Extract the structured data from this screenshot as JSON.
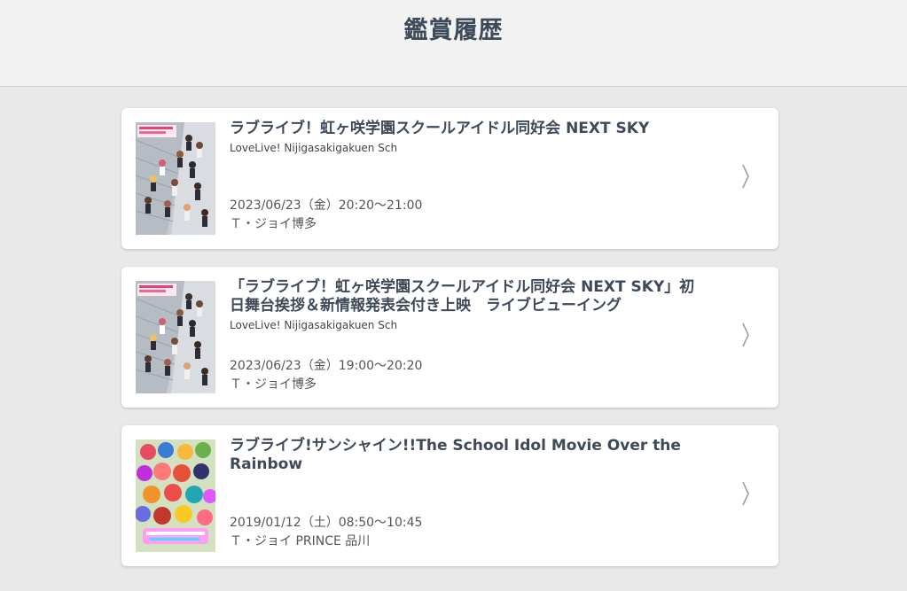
{
  "header": {
    "title": "鑑賞履歴"
  },
  "history": [
    {
      "title": "ラブライブ！虹ヶ咲学園スクールアイドル同好会 NEXT SKY",
      "subtitle": "LoveLive! Nijigasakigakuen Sch",
      "datetime": "2023/06/23（金）20:20〜21:00",
      "theater": "Ｔ・ジョイ博多"
    },
    {
      "title": "「ラブライブ！虹ヶ咲学園スクールアイドル同好会 NEXT SKY」初日舞台挨拶＆新情報発表会付き上映　ライブビューイング",
      "subtitle": "LoveLive! Nijigasakigakuen Sch",
      "datetime": "2023/06/23（金）19:00〜20:20",
      "theater": "Ｔ・ジョイ博多"
    },
    {
      "title": "ラブライブ!サンシャイン!!The School Idol Movie Over the Rainbow",
      "subtitle": "",
      "datetime": "2019/01/12（土）08:50〜10:45",
      "theater": "Ｔ・ジョイ PRINCE 品川"
    }
  ],
  "icons": {
    "chevron": "chevron-right-icon"
  }
}
